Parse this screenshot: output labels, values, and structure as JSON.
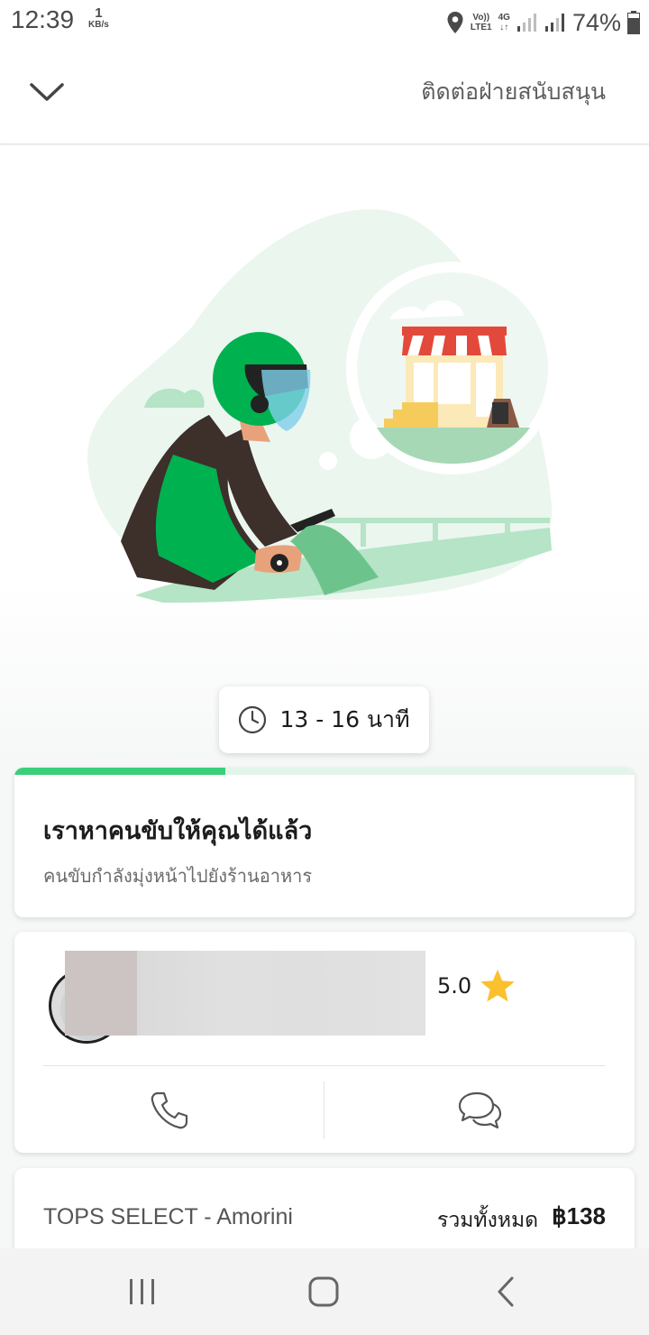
{
  "status_bar": {
    "time": "12:39",
    "net_speed_value": "1",
    "net_speed_unit": "KB/s",
    "volte_top": "Vo))",
    "volte_bottom": "LTE1",
    "network_type": "4G",
    "battery": "74%",
    "icons": [
      "location-icon",
      "signal-icon",
      "battery-icon"
    ]
  },
  "header": {
    "support_label": "ติดต่อฝ่ายสนับสนุน",
    "collapse_icon": "chevron-down-icon"
  },
  "eta": {
    "text": "13 - 16 นาที",
    "icon": "clock-icon"
  },
  "status": {
    "title": "เราหาคนขับให้คุณได้แล้ว",
    "subtitle": "คนขับกำลังมุ่งหน้าไปยังร้านอาหาร",
    "progress": 0.34
  },
  "driver": {
    "rating": "5.0",
    "rating_icon": "star-icon",
    "call_icon": "phone-icon",
    "chat_icon": "chat-icon"
  },
  "order": {
    "merchant": "TOPS SELECT - Amorini",
    "total_label": "รวมทั้งหมด",
    "total_amount": "฿138"
  },
  "colors": {
    "brand_green": "#00b14f",
    "progress_green": "#3ccf7b",
    "star": "#fbc02d"
  }
}
